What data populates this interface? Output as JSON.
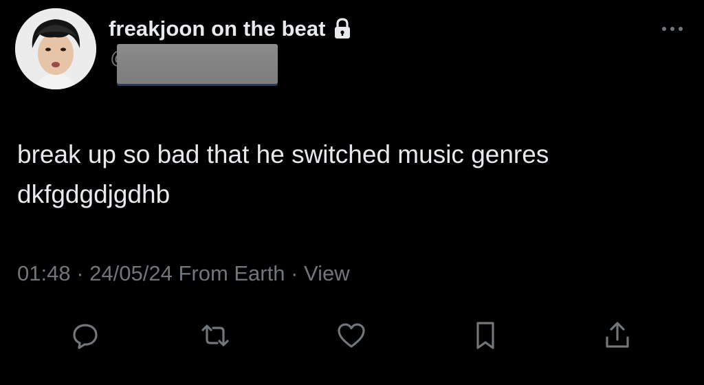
{
  "user": {
    "display_name": "freakjoon on the beat",
    "handle_prefix": "@",
    "handle_redacted": true,
    "verified_lock_icon": "lock-icon"
  },
  "tweet": {
    "text": "break up so bad that he switched music genres\ndkfgdgdjgdhb",
    "time": "01:48",
    "separator": " · ",
    "date": "24/05/24",
    "source": "From Earth",
    "view_label": "View"
  },
  "actions": [
    {
      "name": "reply-button",
      "icon": "reply-icon"
    },
    {
      "name": "retweet-button",
      "icon": "retweet-icon"
    },
    {
      "name": "like-button",
      "icon": "heart-icon"
    },
    {
      "name": "bookmark-button",
      "icon": "bookmark-icon"
    },
    {
      "name": "share-button",
      "icon": "share-icon"
    }
  ],
  "colors": {
    "background": "#000000",
    "primary_text": "#e7e9ea",
    "secondary_text": "#71767b",
    "redaction": "#7d7d7d"
  }
}
